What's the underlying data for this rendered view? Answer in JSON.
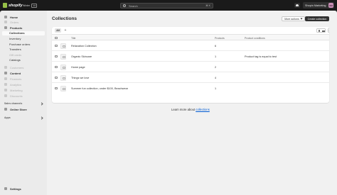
{
  "topbar": {
    "logo_text": "shopify",
    "badge_text": "Winter",
    "badge_version": "'24",
    "search_placeholder": "Search",
    "shortcut": "⌘ K",
    "store_name": "Shopin Marketing",
    "avatar_initials": "SM"
  },
  "sidebar": {
    "items": [
      {
        "label": "Home"
      },
      {
        "label": "Orders"
      },
      {
        "label": "Products"
      },
      {
        "label": "Collections"
      },
      {
        "label": "Inventory"
      },
      {
        "label": "Purchase orders"
      },
      {
        "label": "Transfers"
      },
      {
        "label": "Gift cards"
      },
      {
        "label": "Catalogs"
      },
      {
        "label": "Customers"
      },
      {
        "label": "Content"
      },
      {
        "label": "Finances"
      },
      {
        "label": "Analytics"
      },
      {
        "label": "Marketing"
      },
      {
        "label": "Discounts"
      }
    ],
    "sales_channels_label": "Sales channels",
    "online_store_label": "Online Store",
    "apps_label": "Apps",
    "settings_label": "Settings"
  },
  "page": {
    "title": "Collections",
    "more_actions": "More actions",
    "create_button": "Create collection"
  },
  "table": {
    "tab_all": "All",
    "columns": [
      "Title",
      "Products",
      "Product conditions"
    ],
    "rows": [
      {
        "title": "Relaxation Collection",
        "products": "6",
        "conditions": ""
      },
      {
        "title": "Organic Skincare",
        "products": "1",
        "conditions": "Product tag is equal to test"
      },
      {
        "title": "Home page",
        "products": "2",
        "conditions": ""
      },
      {
        "title": "Things we love",
        "products": "4",
        "conditions": ""
      },
      {
        "title": "Summer fun collection, under $100, Beachwear",
        "products": "1",
        "conditions": ""
      }
    ]
  },
  "footer": {
    "learn_prefix": "Learn more about ",
    "learn_link": "collections"
  },
  "colors": {
    "accent": "#005bd3",
    "primary_button": "#303030",
    "sidebar_bg": "#ebebeb",
    "topbar_bg": "#1a1a1a"
  }
}
